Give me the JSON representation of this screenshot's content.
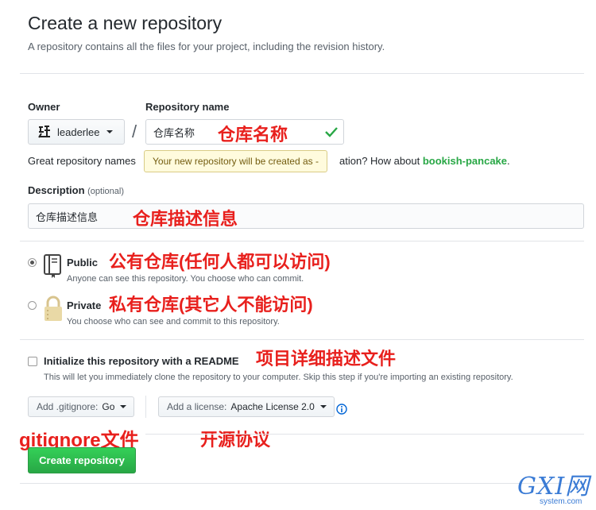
{
  "header": {
    "title": "Create a new repository",
    "subtitle": "A repository contains all the files for your project, including the revision history."
  },
  "owner": {
    "label": "Owner",
    "name": "leaderlee"
  },
  "repo_name": {
    "label": "Repository name",
    "value": "仓库名称"
  },
  "helper": {
    "prefix": "Great repository names",
    "suffix": "ation? How about",
    "suggestion": "bookish-pancake",
    "end": "."
  },
  "tooltip": "Your new repository will be created as -",
  "description": {
    "label": "Description",
    "optional": "(optional)",
    "value": "仓库描述信息"
  },
  "visibility": {
    "public": {
      "title": "Public",
      "note": "Anyone can see this repository. You choose who can commit.",
      "selected": true
    },
    "private": {
      "title": "Private",
      "note": "You choose who can see and commit to this repository.",
      "selected": false
    }
  },
  "init": {
    "title": "Initialize this repository with a README",
    "note": "This will let you immediately clone the repository to your computer. Skip this step if you're importing an existing repository."
  },
  "gitignore": {
    "prefix": "Add .gitignore:",
    "value": "Go"
  },
  "license": {
    "prefix": "Add a license:",
    "value": "Apache License 2.0"
  },
  "create_button": "Create repository",
  "annotations": {
    "repo_name": "仓库名称",
    "description": "仓库描述信息",
    "public": "公有仓库(任何人都可以访问)",
    "private": "私有仓库(其它人不能访问)",
    "readme": "项目详细描述文件",
    "gitignore": "gitignore文件",
    "license": "开源协议"
  },
  "watermark": {
    "main": "GXI网",
    "domain": "system.com"
  },
  "colors": {
    "annotation": "#e8201d",
    "primary": "#28a745",
    "border": "#d1d5da",
    "info": "#0366d6"
  }
}
